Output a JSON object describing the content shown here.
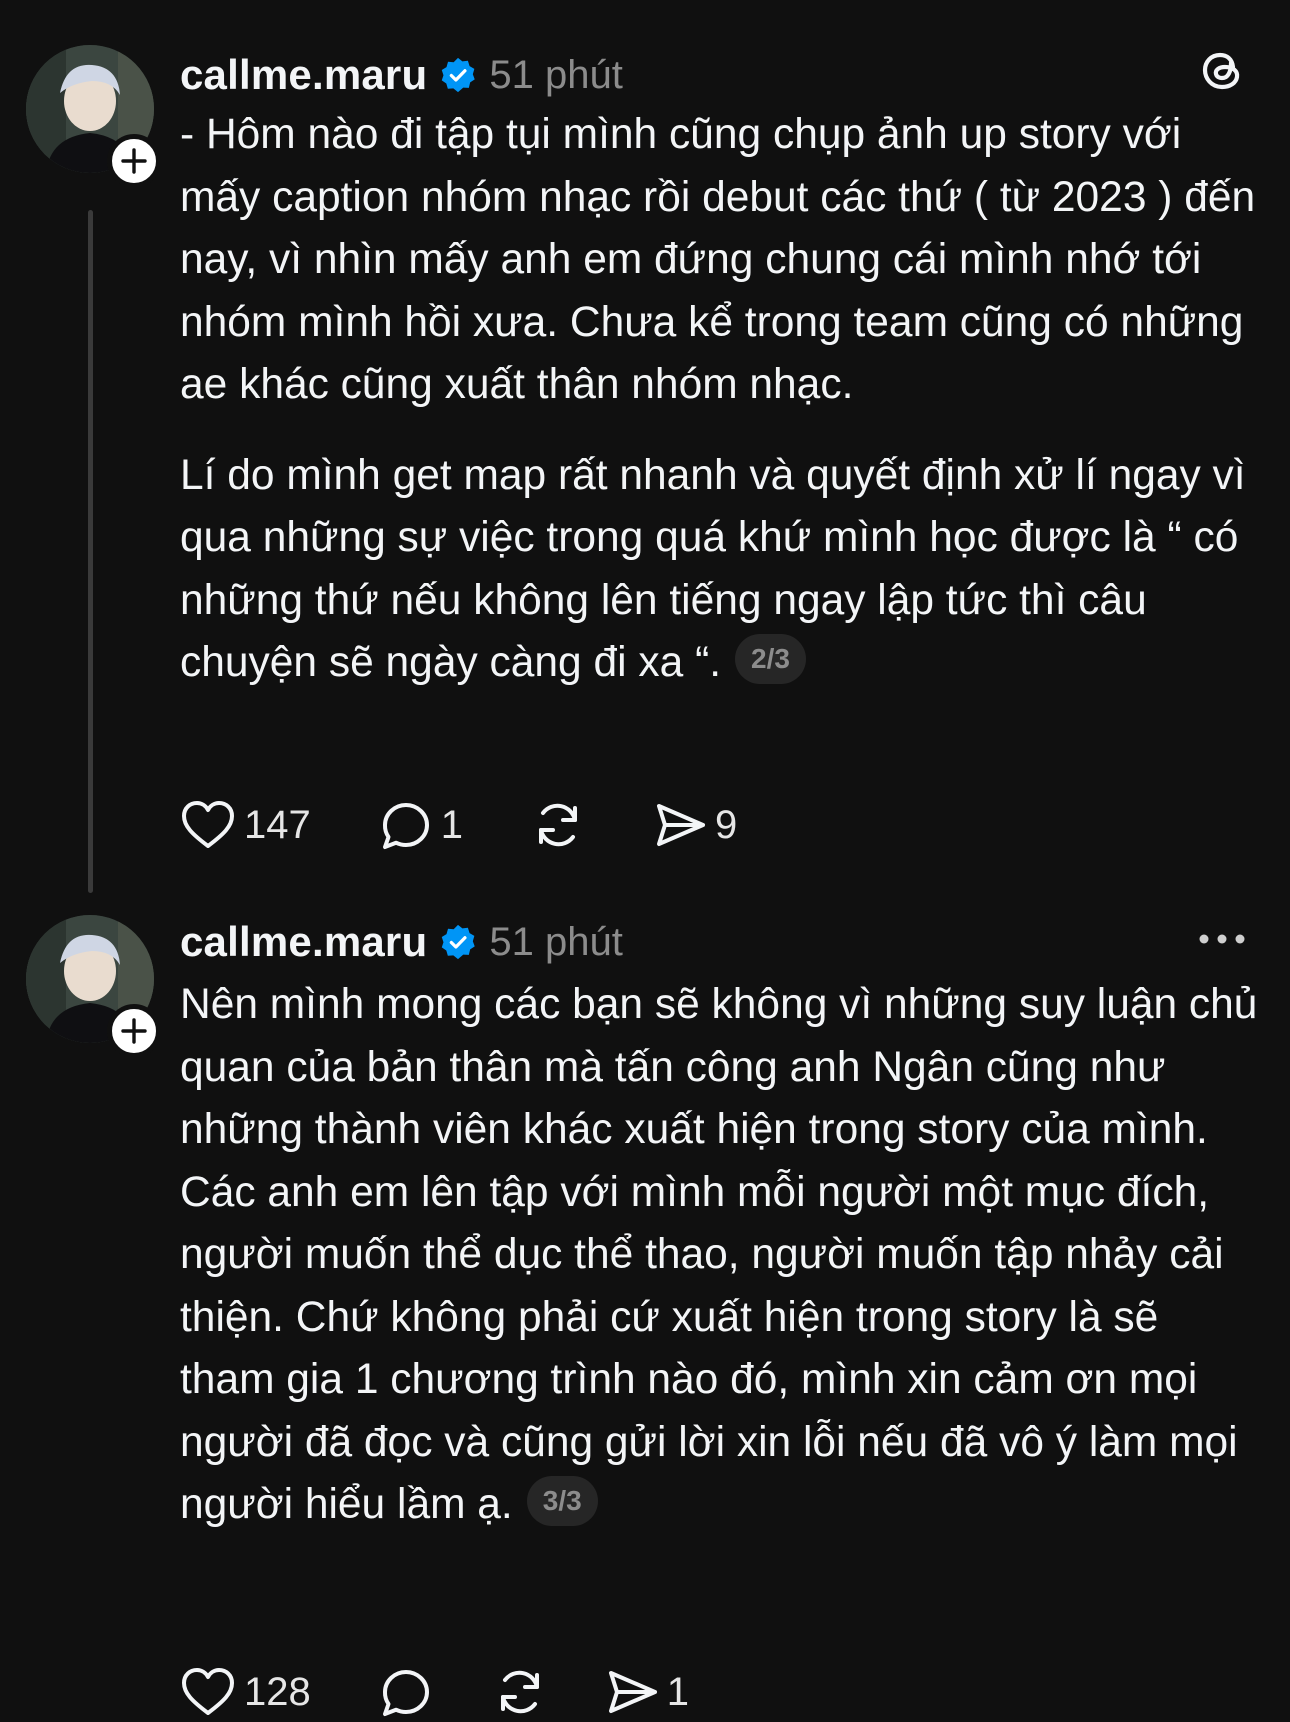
{
  "posts": [
    {
      "username": "callme.maru",
      "time": "51 phút",
      "paragraphs": [
        "- Hôm nào đi tập tụi mình cũng chụp ảnh up story với mấy caption nhóm nhạc rồi debut các thứ ( từ 2023 ) đến nay, vì nhìn mấy anh em đứng chung cái mình nhớ tới nhóm mình hồi xưa. Chưa kể trong team cũng có những ae khác cũng xuất thân nhóm nhạc.",
        "Lí do mình get map rất nhanh và quyết định xử lí ngay vì qua những sự việc trong quá khứ mình học được là “ có những thứ nếu không lên tiếng ngay lập tức thì câu chuyện sẽ ngày càng đi xa “."
      ],
      "page": "2/3",
      "likes": "147",
      "comments": "1",
      "reposts": "",
      "shares": "9"
    },
    {
      "username": "callme.maru",
      "time": "51 phút",
      "paragraphs": [
        "Nên mình mong các bạn sẽ không vì những suy luận chủ quan của bản thân mà tấn công anh Ngân cũng như những thành viên khác xuất hiện trong story của mình. Các anh em lên tập với mình mỗi người một mục đích, người muốn thể dục thể thao, người muốn tập nhảy cải thiện. Chứ không phải cứ xuất hiện trong story là sẽ tham gia 1 chương trình nào đó, mình xin cảm ơn mọi người đã đọc và cũng gửi lời xin lỗi nếu đã vô ý làm mọi người hiểu lầm ạ."
      ],
      "page": "3/3",
      "likes": "128",
      "comments": "",
      "reposts": "",
      "shares": "1"
    }
  ],
  "icons": {
    "verified_color": "#0095f6",
    "threads_logo": "threads-logo-icon",
    "more": "more-options-icon",
    "like": "heart-icon",
    "comment": "comment-icon",
    "repost": "repost-icon",
    "share": "share-icon"
  }
}
